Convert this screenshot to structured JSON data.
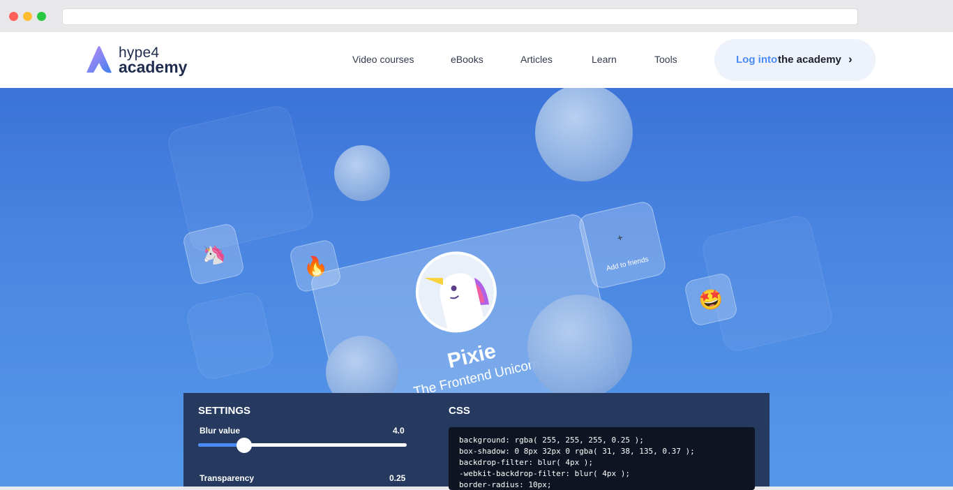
{
  "brand": {
    "logo_top": "hype4",
    "logo_bottom": "academy"
  },
  "nav": {
    "links": [
      "Video courses",
      "eBooks",
      "Articles",
      "Learn",
      "Tools"
    ],
    "login": {
      "part1": "Log into",
      "part2": "the academy",
      "chevron": "›"
    }
  },
  "card": {
    "name": "Pixie",
    "subtitle": "The Frontend Unicorn",
    "add_label": "Add to friends",
    "add_icon": "+"
  },
  "tiles": {
    "unicorn": "🦄",
    "fire": "🔥",
    "star_eyes": "🤩"
  },
  "settings": {
    "heading": "SETTINGS",
    "blur": {
      "label": "Blur value",
      "value": "4.0",
      "fraction": 0.22
    },
    "transparency": {
      "label": "Transparency",
      "value": "0.25"
    }
  },
  "css": {
    "heading": "CSS",
    "lines": [
      "background: rgba( 255, 255, 255, 0.25 );",
      "box-shadow: 0 8px 32px 0 rgba( 31, 38, 135, 0.37 );",
      "backdrop-filter: blur( 4px );",
      "-webkit-backdrop-filter: blur( 4px );",
      "border-radius: 10px;"
    ]
  },
  "colors": {
    "accent": "#4a8bf5",
    "navy": "#1f2c4d",
    "panel": "#263a5f"
  }
}
